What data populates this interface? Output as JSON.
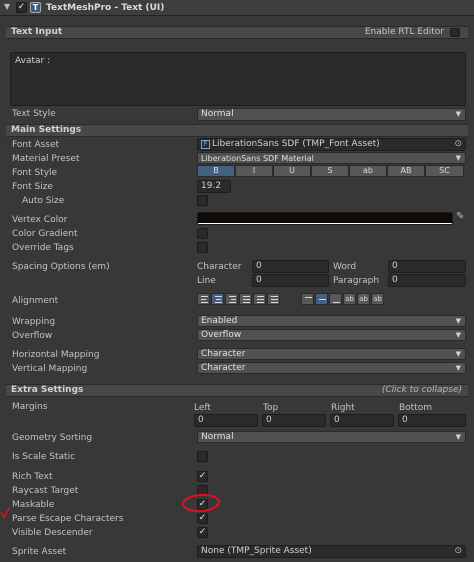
{
  "component": {
    "title": "TextMeshPro - Text (UI)",
    "enabled": true
  },
  "text_input": {
    "section": "Text Input",
    "rtl_label": "Enable RTL Editor",
    "content": "Avatar :",
    "text_style_label": "Text Style",
    "text_style_value": "Normal"
  },
  "main": {
    "section": "Main Settings",
    "font_asset_label": "Font Asset",
    "font_asset_value": "LiberationSans SDF (TMP_Font Asset)",
    "material_preset_label": "Material Preset",
    "material_preset_value": "LiberationSans SDF Material",
    "font_style_label": "Font Style",
    "font_style_buttons": [
      "B",
      "I",
      "U",
      "S",
      "ab",
      "AB",
      "SC"
    ],
    "font_size_label": "Font Size",
    "font_size_value": "19.2",
    "auto_size_label": "Auto Size",
    "vertex_color_label": "Vertex Color",
    "vertex_color": "#0e0a08",
    "color_gradient_label": "Color Gradient",
    "override_tags_label": "Override Tags",
    "spacing_label": "Spacing Options (em)",
    "spacing": {
      "character_label": "Character",
      "character_value": "0",
      "word_label": "Word",
      "word_value": "0",
      "line_label": "Line",
      "line_value": "0",
      "paragraph_label": "Paragraph",
      "paragraph_value": "0"
    },
    "alignment_label": "Alignment",
    "wrapping_label": "Wrapping",
    "wrapping_value": "Enabled",
    "overflow_label": "Overflow",
    "overflow_value": "Overflow",
    "hmap_label": "Horizontal Mapping",
    "hmap_value": "Character",
    "vmap_label": "Vertical Mapping",
    "vmap_value": "Character"
  },
  "extra": {
    "section": "Extra Settings",
    "collapse_hint": "(Click to collapse)",
    "margins_label": "Margins",
    "margins": [
      {
        "label": "Left",
        "value": "0"
      },
      {
        "label": "Top",
        "value": "0"
      },
      {
        "label": "Right",
        "value": "0"
      },
      {
        "label": "Bottom",
        "value": "0"
      }
    ],
    "geometry_label": "Geometry Sorting",
    "geometry_value": "Normal",
    "scale_static_label": "Is Scale Static",
    "rich_text_label": "Rich Text",
    "raycast_label": "Raycast Target",
    "maskable_label": "Maskable",
    "parse_escape_label": "Parse Escape Characters",
    "visible_descender_label": "Visible Descender",
    "sprite_asset_label": "Sprite Asset",
    "sprite_asset_value": "None (TMP_Sprite Asset)"
  },
  "colors": {
    "accent": "#46607f",
    "annotation": "#e0101e"
  },
  "check_glyph": "✓"
}
